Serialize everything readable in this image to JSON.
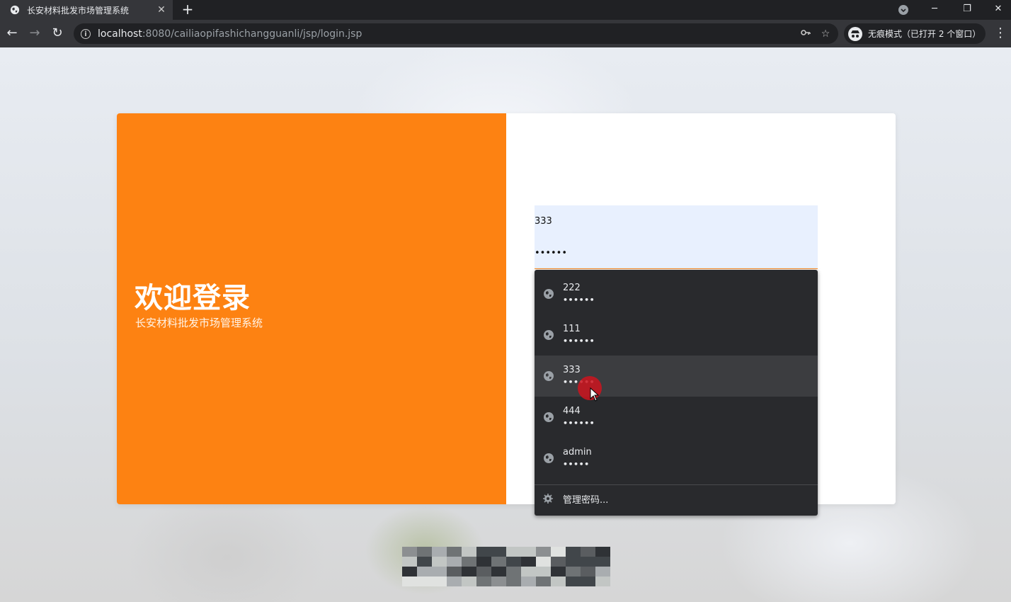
{
  "browser": {
    "tab_title": "长安材料批发市场管理系统",
    "url_host": "localhost",
    "url_rest": ":8080/cailiaopifashichangguanli/jsp/login.jsp",
    "incognito_label": "无痕模式（已打开 2 个窗口）"
  },
  "login": {
    "welcome": "欢迎登录",
    "subtitle": "长安材料批发市场管理系统",
    "username_value": "333",
    "password_value": "••••••"
  },
  "autofill": {
    "items": [
      {
        "user": "222",
        "pass": "••••••"
      },
      {
        "user": "111",
        "pass": "••••••"
      },
      {
        "user": "333",
        "pass": "••••••"
      },
      {
        "user": "444",
        "pass": "••••••"
      },
      {
        "user": "admin",
        "pass": "•••••"
      }
    ],
    "manage_label": "管理密码..."
  },
  "colors": {
    "accent": "#fd8212",
    "autofill_bg": "#292a2d",
    "field_bg": "#e8f0fe"
  }
}
